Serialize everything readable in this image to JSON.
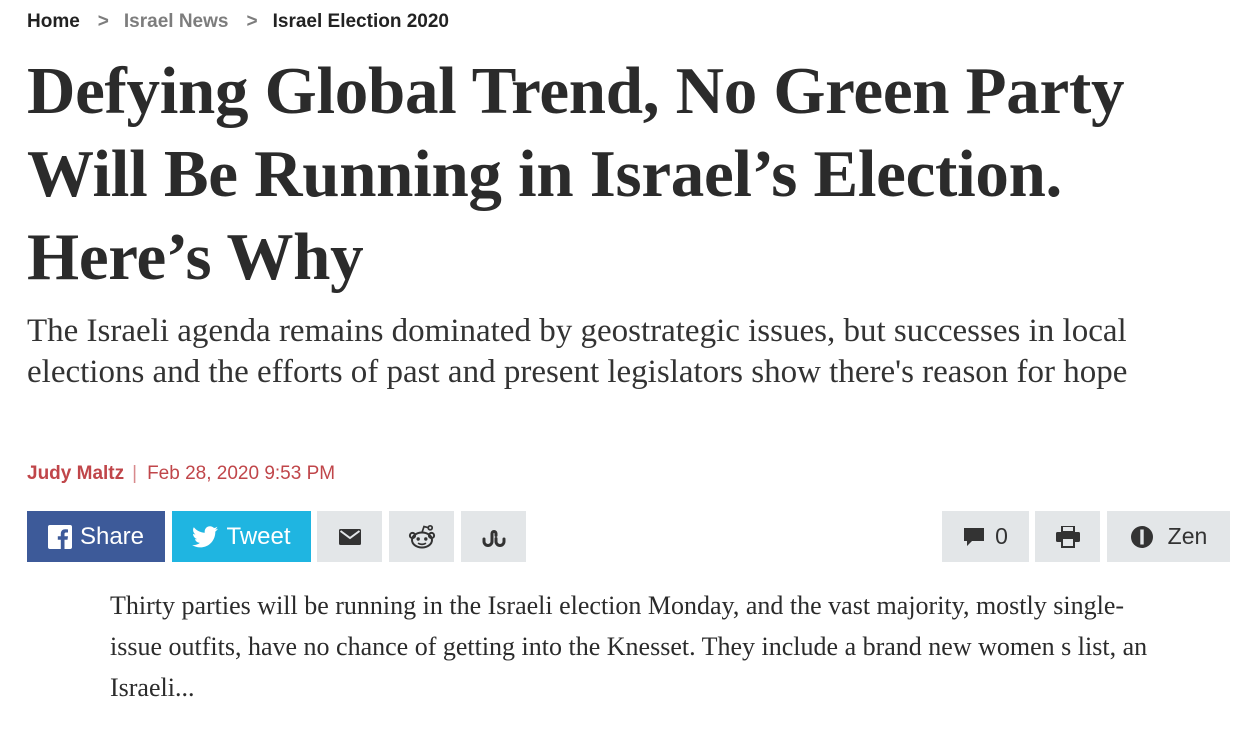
{
  "breadcrumb": {
    "home": "Home",
    "section": "Israel News",
    "current": "Israel Election 2020",
    "separator": ">"
  },
  "article": {
    "headline": "Defying Global Trend, No Green Party Will Be Running in Israel’s Election. Here’s Why",
    "dek": "The Israeli agenda remains dominated by geostrategic issues, but successes in local elections and the efforts of past and present legislators show there's reason for hope",
    "author": "Judy Maltz",
    "byline_divider": "|",
    "date": "Feb 28, 2020 9:53 PM",
    "body": "Thirty parties will be running in the Israeli election Monday, and the vast majority, mostly single-issue outfits, have no chance of getting into the Knesset. They include a brand new women s list, an Israeli..."
  },
  "share": {
    "facebook_label": "Share",
    "twitter_label": "Tweet",
    "comments_count": "0",
    "zen_label": "Zen",
    "icons": {
      "facebook": "facebook-icon",
      "twitter": "twitter-icon",
      "email": "envelope-icon",
      "reddit": "reddit-icon",
      "stumbleupon": "stumbleupon-icon",
      "comments": "comment-bubble-icon",
      "print": "printer-icon",
      "zen": "zen-mode-icon"
    }
  },
  "colors": {
    "facebook": "#3d5a99",
    "twitter": "#1fb5e1",
    "gray_button": "#e3e6e8",
    "byline": "#c0464a",
    "breadcrumb_muted": "#7d7d7d"
  }
}
